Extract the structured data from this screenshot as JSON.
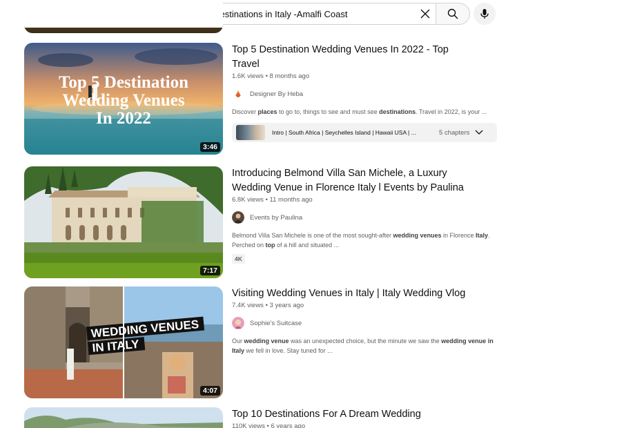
{
  "search": {
    "query": "famous wedding destinations in Italy -Amalfi Coast"
  },
  "icons": {
    "clear": "close-icon",
    "search": "search-icon",
    "mic": "microphone-icon"
  },
  "videos": [
    {
      "title_line1": "Top 5 Destination Wedding Venues In 2022 - Top",
      "title_line2": "Travel",
      "meta": "1.6K views • 8 months ago",
      "channel": "Designer By Heba",
      "description": [
        {
          "t": "Discover "
        },
        {
          "t": "places",
          "b": true
        },
        {
          "t": " to go to, things to see and must see "
        },
        {
          "t": "destinations",
          "b": true
        },
        {
          "t": ". Travel in 2022, is your ..."
        }
      ],
      "duration": "3:46",
      "thumb_text": [
        "Top 5 Destination",
        "Wedding Venues",
        "In 2022"
      ],
      "chapters_text": "Intro | South Africa | Seychelles Island | Hawaii USA | ...",
      "chapters_count": "5 chapters"
    },
    {
      "title_line1": "Introducing Belmond Villa San Michele, a Luxury",
      "title_line2": "Wedding Venue in Florence Italy l Events by Paulina",
      "meta": "6.8K views • 11 months ago",
      "channel": "Events by Paulina",
      "description": [
        {
          "t": "Belmond Villa San Michele is one of the most sought-after "
        },
        {
          "t": "wedding venues",
          "b": true
        },
        {
          "t": " in Florence "
        },
        {
          "t": "Italy",
          "b": true
        },
        {
          "t": ". Perched on "
        },
        {
          "t": "top",
          "b": true
        },
        {
          "t": " of a hill and situated ..."
        }
      ],
      "duration": "7:17",
      "badge": "4K"
    },
    {
      "title_line1": "Visiting Wedding Venues in Italy | Italy Wedding Vlog",
      "meta": "7.4K views • 3 years ago",
      "channel": "Sophie's Suitcase",
      "description": [
        {
          "t": "Our "
        },
        {
          "t": "wedding venue",
          "b": true
        },
        {
          "t": " was an unexpected choice, but the minute we saw the "
        },
        {
          "t": "wedding venue",
          "b": true
        },
        {
          "t": " "
        },
        {
          "t": "in Italy",
          "b": true
        },
        {
          "t": " we fell in love. Stay tuned for ..."
        }
      ],
      "duration": "4:07",
      "thumb_text": [
        "WEDDING VENUES",
        "IN ITALY"
      ]
    },
    {
      "title_line1": "Top 10 Destinations For A Dream Wedding",
      "meta": "110K views • 6 years ago"
    }
  ],
  "colors": {
    "text_primary": "#0f0f0f",
    "text_secondary": "#606060",
    "chip_bg": "#f2f2f2"
  }
}
